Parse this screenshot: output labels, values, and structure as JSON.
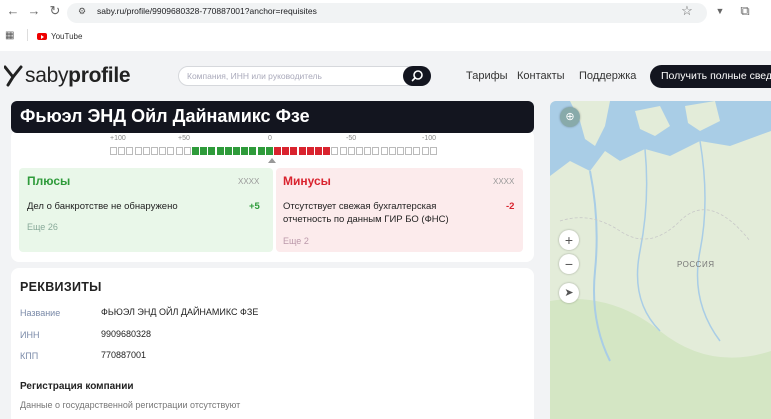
{
  "browser": {
    "url": "saby.ru/profile/9909680328-770887001?anchor=requisites",
    "bookmark_youtube": "YouTube"
  },
  "header": {
    "logo_light": "saby",
    "logo_bold": "profile",
    "search_placeholder": "Компания, ИНН или руководитель",
    "nav": [
      "Тарифы",
      "Контакты",
      "Поддержка"
    ],
    "cta": "Получить полные сведения"
  },
  "title": "Фьюэл ЭНД Ойл Дайнамикс Фзе",
  "score": {
    "ticks": [
      "+100",
      "+50",
      "0",
      "-50",
      "-100"
    ],
    "plus": {
      "heading": "Плюсы",
      "badge": "XXXX",
      "item": "Дел о банкротстве не обнаружено",
      "points": "+5",
      "more": "Еще 26"
    },
    "minus": {
      "heading": "Минусы",
      "badge": "XXXX",
      "item_line1": "Отсутствует свежая бухгалтерская",
      "item_line2": "отчетность по данным ГИР БО (ФНС)",
      "points": "-2",
      "more": "Еще 2"
    }
  },
  "requisites": {
    "heading": "РЕКВИЗИТЫ",
    "rows": [
      {
        "label": "Название",
        "value": "ФЬЮЭЛ ЭНД ОЙЛ ДАЙНАМИКС ФЗЕ"
      },
      {
        "label": "ИНН",
        "value": "9909680328"
      },
      {
        "label": "КПП",
        "value": "770887001"
      }
    ],
    "registration_heading": "Регистрация компании",
    "registration_text": "Данные о государственной регистрации отсутствуют"
  },
  "map": {
    "label": "РОССИЯ",
    "zoom_in": "+",
    "zoom_out": "−"
  },
  "colors": {
    "dark": "#13151f",
    "plus_green": "#2e9b3a",
    "minus_red": "#d9232e"
  }
}
